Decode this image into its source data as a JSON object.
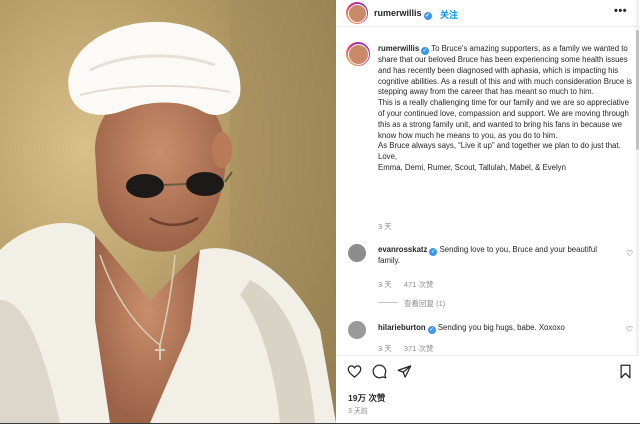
{
  "post": {
    "username": "rumerwillis",
    "follow_label": "关注",
    "more_label": "•••"
  },
  "caption": {
    "username": "rumerwillis",
    "paragraph1": "To Bruce's amazing supporters, as a family we wanted to share that our beloved Bruce has been experiencing some health issues and has recently been diagnosed with aphasia, which is impacting his cognitive abilities. As a result of this and with much consideration Bruce is stepping away from the career that has meant so much to him.",
    "paragraph2": "This is a really challenging time for our family and we are so appreciative of your continued love, compassion and support. We are moving through this as a strong family unit, and wanted to bring his fans in because we know how much he means to you, as you do to him.",
    "paragraph3": "As Bruce always says, “Live it up” and together we plan to do just that.",
    "paragraph4": "Love,",
    "paragraph5": "Emma, Demi, Rumer, Scout, Tallulah, Mabel, & Evelyn",
    "age": "3 天"
  },
  "comments": [
    {
      "username": "evanrosskatz",
      "text": "Sending love to you, Bruce and your beautiful family.",
      "age": "3 天",
      "likes": "471 次赞",
      "replies": "查看回复 (1)"
    },
    {
      "username": "hilarieburton",
      "text": "Sending you big hugs, babe. Xoxoxo",
      "age": "3 天",
      "likes": "371 次赞"
    }
  ],
  "footer": {
    "likes": "19万 次赞",
    "time": "3 天前"
  },
  "icons": {
    "heart": "heart-icon",
    "comment": "comment-icon",
    "share": "share-icon",
    "save": "bookmark-icon",
    "verified": "verified-badge-icon"
  },
  "colors": {
    "accent": "#0095f6",
    "verified": "#3897f0",
    "muted": "#8e8e8e"
  }
}
